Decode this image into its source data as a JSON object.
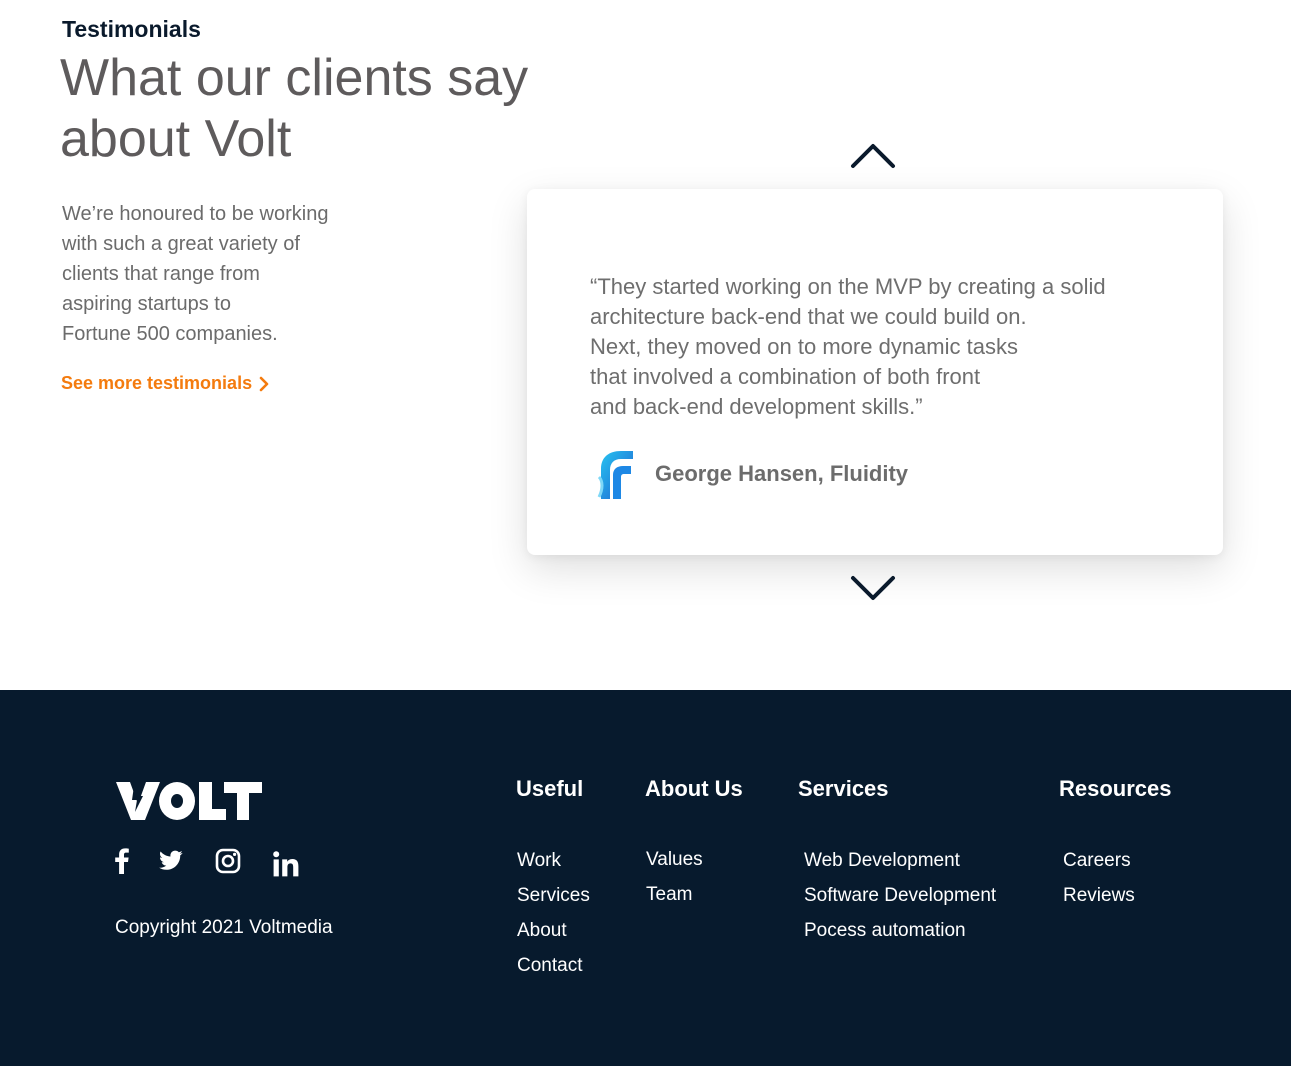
{
  "testimonials": {
    "eyebrow": "Testimonials",
    "headline": "What our clients say about Volt",
    "intro_lines": [
      "We’re honoured to be working",
      "with such a great variety of",
      "clients that  range from",
      "aspiring startups to",
      "Fortune 500 companies."
    ],
    "see_more": "See more testimonials",
    "quote_lines": [
      "“They started working on the MVP by creating a solid",
      "architecture back-end that we could build on.",
      "Next, they moved on to more dynamic tasks",
      "that involved a combination of both front",
      "and back-end development skills.”"
    ],
    "author": "George Hansen, Fluidity",
    "author_logo_icon": "fluidity-logo-icon",
    "nav_icons": [
      "chevron-up-icon",
      "chevron-down-icon"
    ]
  },
  "footer": {
    "logo_icon": "volt-logo",
    "logo_text": "VOLT",
    "social_icons": [
      "facebook-icon",
      "twitter-icon",
      "instagram-icon",
      "linkedin-icon"
    ],
    "copyright": "Copyright  2021 Voltmedia",
    "columns": [
      {
        "title": "Useful",
        "links": [
          "Work",
          "Services",
          "About",
          "Contact"
        ]
      },
      {
        "title": "About Us",
        "links": [
          "Values",
          "Team"
        ]
      },
      {
        "title": "Services",
        "links": [
          "Web Development",
          "Software Development",
          "Pocess automation"
        ]
      },
      {
        "title": "Resources",
        "links": [
          "Careers",
          "Reviews"
        ]
      }
    ]
  },
  "colors": {
    "accent": "#f47b0e",
    "footer_bg": "#071a2d",
    "heading_dark": "#0a1a2c",
    "headline_gray": "#5e5b5c",
    "body_gray": "#6b6b6b"
  }
}
